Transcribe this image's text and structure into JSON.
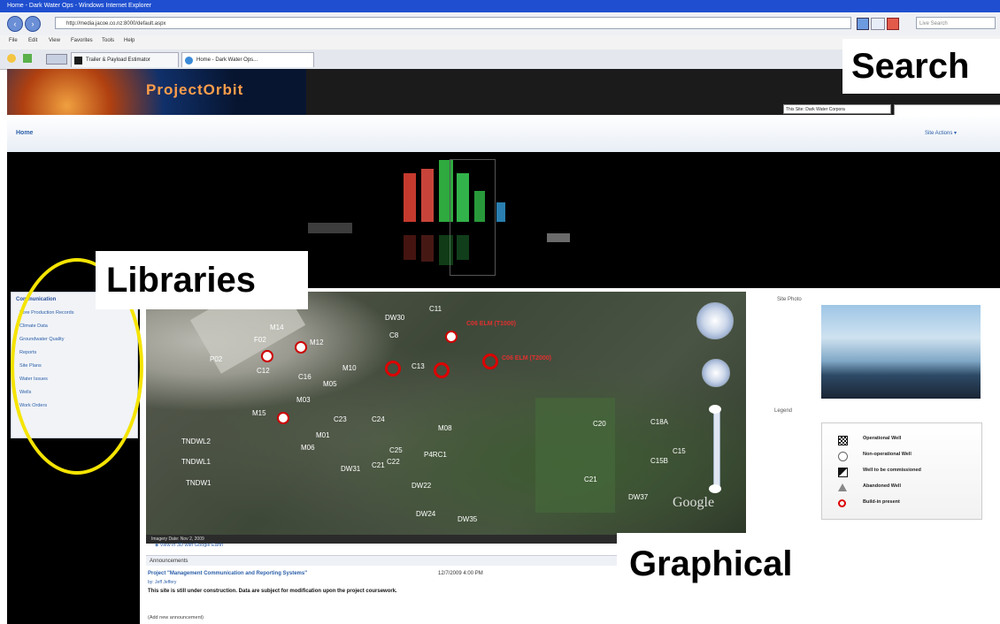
{
  "browser": {
    "title": "Home - Dark Water Ops - Windows Internet Explorer",
    "url": "http://media.jacoe.co.nz:8000/default.aspx",
    "search_placeholder": "Live Search",
    "menu": [
      "File",
      "Edit",
      "View",
      "Favorites",
      "Tools",
      "Help"
    ],
    "tabs": [
      "Trailer & Payload Estimator",
      "Home - Dark Water Ops..."
    ]
  },
  "site": {
    "logo": "ProjectOrbit",
    "site_select": "This Site: Dark Water Corpora",
    "home": "Home",
    "site_actions": "Site Actions"
  },
  "libraries": {
    "heading": "Communication",
    "items": [
      "Bore Production Records",
      "Climate Data",
      "Groundwater Quality",
      "Reports",
      "Site Plans",
      "Water Issues",
      "Wells",
      "Work Orders"
    ]
  },
  "map": {
    "labels": [
      "M14",
      "DW30",
      "C11",
      "M12",
      "C8",
      "F02",
      "P02",
      "C12",
      "C16",
      "M10",
      "M05",
      "M03",
      "C13",
      "M15",
      "C23",
      "M01",
      "C24",
      "M06",
      "M08",
      "C25",
      "C22",
      "C21",
      "DW31",
      "P4RC1",
      "DW22",
      "DW24",
      "DW35",
      "C20",
      "C18A",
      "C15",
      "C15B",
      "C21",
      "DW37",
      "TNDWL2",
      "TNDWL1",
      "TNDW1"
    ],
    "red_labels": [
      "C06 ELM (T1000)",
      "C06 ELM (T2000)"
    ],
    "footer": "Imagery Date: Nov 2, 2009",
    "google": "Google",
    "earth_link": "View in 3D with Google Earth"
  },
  "announcements": {
    "heading": "Announcements",
    "title": "Project \"Management Communication and Reporting Systems\"",
    "date": "12/7/2009 4:00 PM",
    "author": "by: Jeff Jeffery",
    "body": "This site is still under construction. Data are subject for modification upon the project coursework.",
    "footer": "(Add new announcement)"
  },
  "right": {
    "photo_label": "Site Photo",
    "legend_label": "Legend",
    "legend": [
      {
        "label": "Operational Well",
        "icon": "checker"
      },
      {
        "label": "Non-operational Well",
        "icon": "circle"
      },
      {
        "label": "Well to be commissioned",
        "icon": "checker-half"
      },
      {
        "label": "Abandoned Well",
        "icon": "triangle"
      },
      {
        "label": "Build-in present",
        "icon": "ring"
      }
    ]
  },
  "annotations": {
    "search": "Search",
    "libraries": "Libraries",
    "graphical": "Graphical"
  },
  "colors": {
    "highlight": "#f5e400",
    "link": "#2a5ea8",
    "well_ring": "#dd0000"
  }
}
